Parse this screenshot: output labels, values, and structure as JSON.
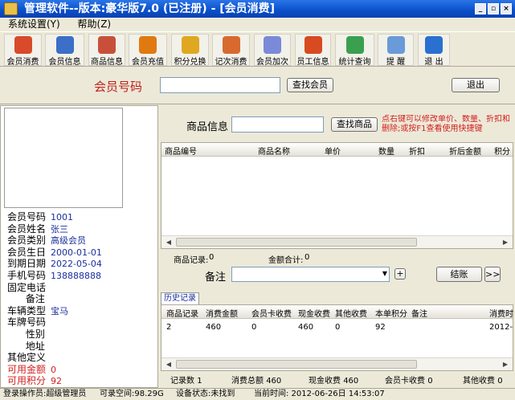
{
  "window": {
    "title": "管理软件--版本:豪华版7.0 (已注册) - [会员消费]",
    "minimize": "_",
    "restore": "▫",
    "close": "×"
  },
  "menu": [
    "系统设置(Y)",
    "帮助(Z)"
  ],
  "toolbar": [
    {
      "label": "会员消费",
      "icon": "gift-icon",
      "color": "#d84a2a"
    },
    {
      "label": "会员信息",
      "icon": "people-icon",
      "color": "#3b6fc8"
    },
    {
      "label": "商品信息",
      "icon": "grid-icon",
      "color": "#c8503b"
    },
    {
      "label": "会员充值",
      "icon": "coin-icon",
      "color": "#e07a10"
    },
    {
      "label": "积分兑换",
      "icon": "balloon-icon",
      "color": "#e0a820"
    },
    {
      "label": "记次消费",
      "icon": "book-icon",
      "color": "#d86a30"
    },
    {
      "label": "会员加次",
      "icon": "pencil-icon",
      "color": "#7a8ad8"
    },
    {
      "label": "员工信息",
      "icon": "person-icon",
      "color": "#d84a20"
    },
    {
      "label": "统计查询",
      "icon": "chart-icon",
      "color": "#3aa050"
    },
    {
      "label": "提 醒",
      "icon": "bell-icon",
      "color": "#6a9ad8"
    },
    {
      "label": "退 出",
      "icon": "exit-icon",
      "color": "#2a70d0"
    }
  ],
  "member": {
    "label": "会员号码",
    "search": "查找会员",
    "exit": "退出"
  },
  "info": [
    {
      "k": "会员号码",
      "v": "1001"
    },
    {
      "k": "会员姓名",
      "v": "张三"
    },
    {
      "k": "会员类别",
      "v": "高级会员"
    },
    {
      "k": "会员生日",
      "v": "2000-01-01"
    },
    {
      "k": "到期日期",
      "v": "2022-05-04"
    },
    {
      "k": "手机号码",
      "v": "138888888"
    },
    {
      "k": "固定电话",
      "v": ""
    },
    {
      "k": "      备注",
      "v": ""
    },
    {
      "k": "车辆类型",
      "v": "宝马"
    },
    {
      "k": "车牌号码",
      "v": ""
    },
    {
      "k": "      性别",
      "v": ""
    },
    {
      "k": "      地址",
      "v": ""
    },
    {
      "k": "其他定义",
      "v": ""
    },
    {
      "k": "可用金额",
      "v": "0",
      "red": true
    },
    {
      "k": "可用积分",
      "v": "92",
      "red": true
    }
  ],
  "product": {
    "label": "商品信息",
    "search": "查找商品",
    "hint": "点右键可以修改单价、数量、折扣和删除;或按F1查看使用快捷键",
    "headers": [
      "商品编号",
      "商品名称",
      "单价",
      "数量",
      "折扣",
      "折后金额",
      "积分"
    ],
    "records_label": "商品记录:",
    "records": "0",
    "total_label": "金额合计:",
    "total": "0"
  },
  "remark": {
    "label": "备注",
    "plus": "+",
    "checkout": "结账",
    "more": ">>"
  },
  "history": {
    "tab": "历史记录",
    "headers": [
      "商品记录",
      "消费金额",
      "会员卡收费",
      "现金收费",
      "其他收费",
      "本单积分",
      "备注",
      "消费时"
    ],
    "rows": [
      [
        "2",
        "460",
        "0",
        "460",
        "0",
        "92",
        "",
        "2012-"
      ]
    ],
    "summary": [
      {
        "k": "记录数",
        "v": "1"
      },
      {
        "k": "消费总额",
        "v": "460"
      },
      {
        "k": "现金收费",
        "v": "460"
      },
      {
        "k": "会员卡收费",
        "v": "0"
      },
      {
        "k": "其他收费",
        "v": "0"
      }
    ]
  },
  "status": {
    "operator": "登录操作员:超级管理员",
    "space": "可录空间:98.29G",
    "device": "设备状态:未找到",
    "time": "当前时间: 2012-06-26日 14:53:07"
  }
}
